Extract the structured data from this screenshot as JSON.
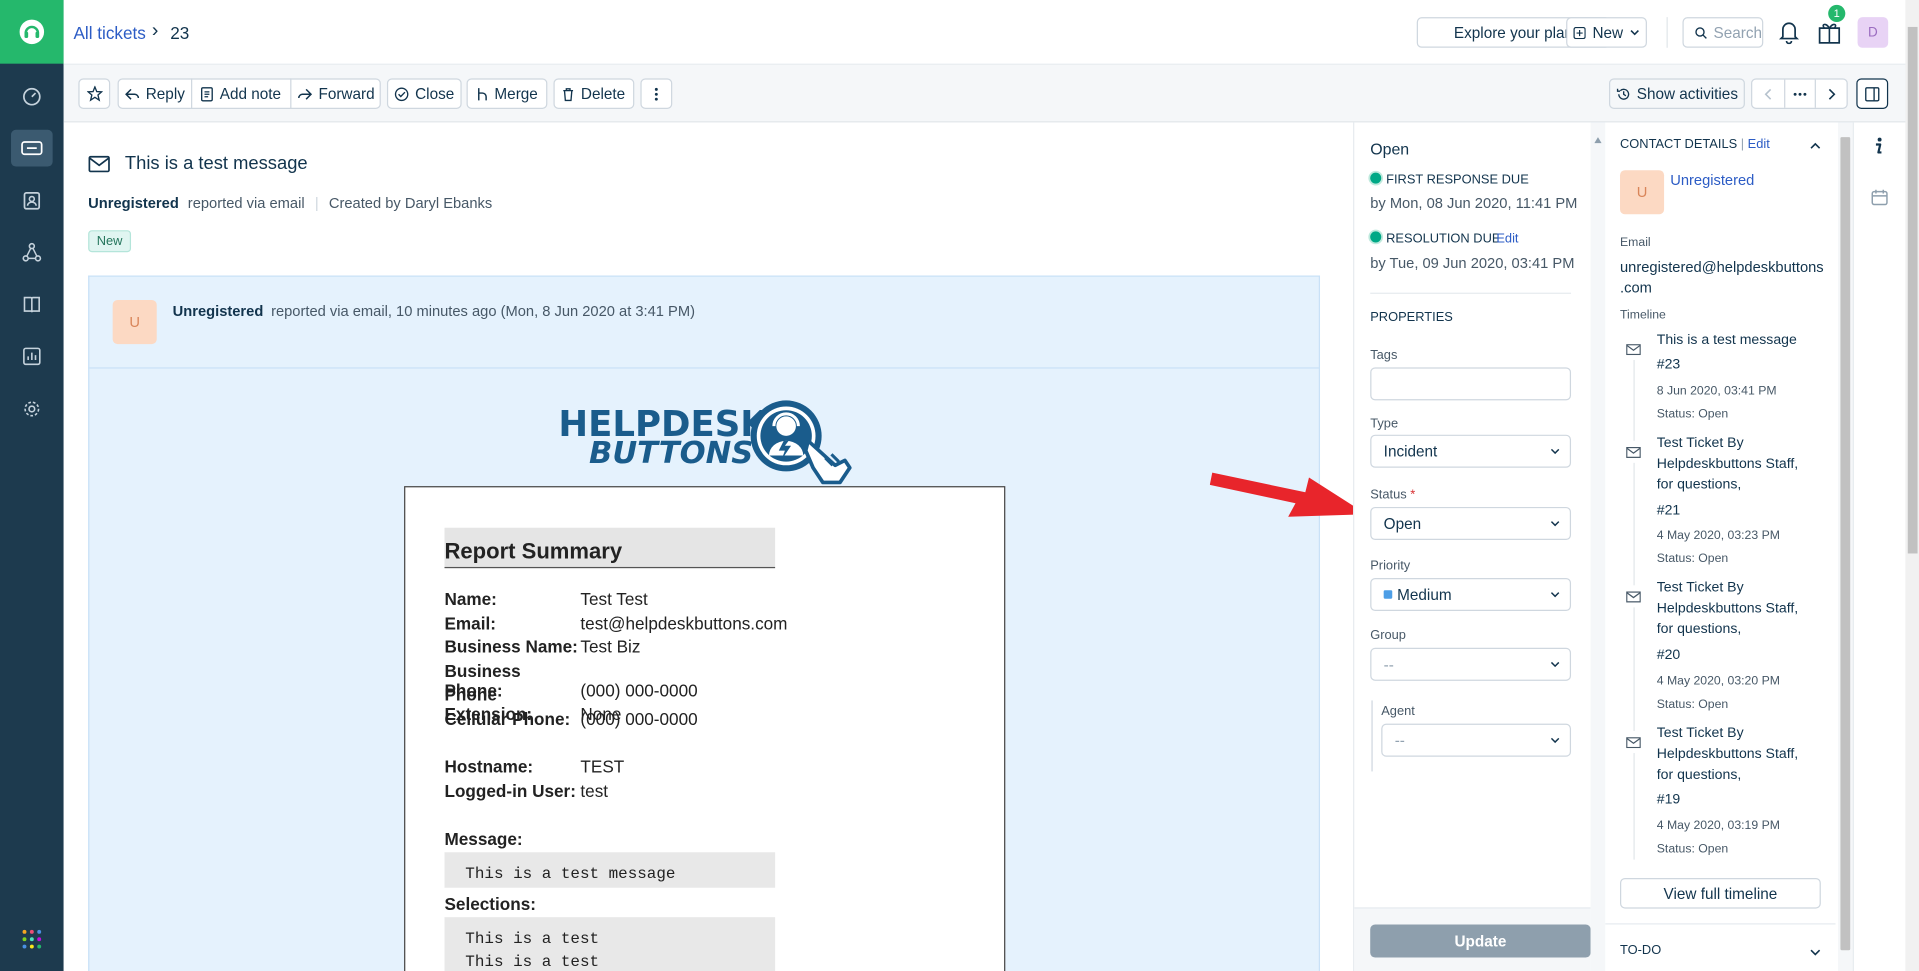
{
  "header": {
    "breadcrumb_link": "All tickets",
    "breadcrumb_sep": "›",
    "ticket_number": "23",
    "explore_plan": "Explore your plan",
    "new_label": "New",
    "search_placeholder": "Search",
    "gift_badge": "1",
    "avatar_initial": "D"
  },
  "toolbar": {
    "reply": "Reply",
    "add_note": "Add note",
    "forward": "Forward",
    "close": "Close",
    "merge": "Merge",
    "delete": "Delete",
    "show_activities": "Show activities"
  },
  "ticket": {
    "subject": "This is a test message",
    "requester": "Unregistered",
    "via": "reported via email",
    "created_by": "Created by Daryl Ebanks",
    "status_badge": "New"
  },
  "message": {
    "avatar_initial": "U",
    "sender": "Unregistered",
    "meta": "reported via email, 10 minutes ago (Mon, 8 Jun 2020 at 3:41 PM)",
    "logo_line1": "HELPDESK",
    "logo_line2": "BUTTONS",
    "report_title": "Report Summary",
    "fields": [
      {
        "label": "Name:",
        "value": "Test Test"
      },
      {
        "label": "Email:",
        "value": "test@helpdeskbuttons.com"
      },
      {
        "label": "Business Name:",
        "value": "Test Biz"
      },
      {
        "label": "Business Phone:",
        "value": "(000) 000-0000"
      },
      {
        "label": "Phone Extension:",
        "value": "None"
      },
      {
        "label": "Cellular Phone:",
        "value": "(000) 000-0000"
      },
      {
        "label": "Hostname:",
        "value": "TEST"
      },
      {
        "label": "Logged-in User:",
        "value": "test"
      }
    ],
    "message_label": "Message:",
    "message_text": "This is a test message",
    "selections_label": "Selections:",
    "selections": [
      "This is a test",
      "This is a test"
    ]
  },
  "properties": {
    "status_text": "Open",
    "first_response_label": "FIRST RESPONSE DUE",
    "first_response_date": "by Mon, 08 Jun 2020, 11:41 PM",
    "resolution_label": "RESOLUTION DUE",
    "resolution_edit": "Edit",
    "resolution_date": "by Tue, 09 Jun 2020, 03:41 PM",
    "section_title": "PROPERTIES",
    "tags_label": "Tags",
    "type_label": "Type",
    "type_value": "Incident",
    "status_label": "Status",
    "required_mark": "*",
    "status_value": "Open",
    "priority_label": "Priority",
    "priority_value": "Medium",
    "group_label": "Group",
    "group_value": "--",
    "agent_label": "Agent",
    "agent_value": "--",
    "update_button": "Update",
    "status_color_ok": "#00a886",
    "priority_color": "#4d9ee6"
  },
  "contact": {
    "title": "CONTACT DETAILS",
    "sep": "|",
    "edit": "Edit",
    "avatar_initial": "U",
    "name": "Unregistered",
    "email_label": "Email",
    "email_line1": "unregistered@helpdeskbuttons",
    "email_line2": ".com",
    "timeline_label": "Timeline",
    "timeline": [
      {
        "title_lines": [
          "This is a test message",
          "#23"
        ],
        "date": "8 Jun 2020, 03:41 PM",
        "status": "Status: Open"
      },
      {
        "title_lines": [
          "Test Ticket By",
          "Helpdeskbuttons Staff,",
          "for questions,",
          "#21"
        ],
        "date": "4 May 2020, 03:23 PM",
        "status": "Status: Open"
      },
      {
        "title_lines": [
          "Test Ticket By",
          "Helpdeskbuttons Staff,",
          "for questions,",
          "#20"
        ],
        "date": "4 May 2020, 03:20 PM",
        "status": "Status: Open"
      },
      {
        "title_lines": [
          "Test Ticket By",
          "Helpdeskbuttons Staff,",
          "for questions,",
          "#19"
        ],
        "date": "4 May 2020, 03:19 PM",
        "status": "Status: Open"
      }
    ],
    "view_timeline": "View full timeline",
    "todo": "TO-DO"
  },
  "colors": {
    "nav_bg": "#1d3a4e",
    "brand_green": "#25b86c",
    "link_blue": "#2c5cc5",
    "arrow_red": "#e8252b"
  }
}
